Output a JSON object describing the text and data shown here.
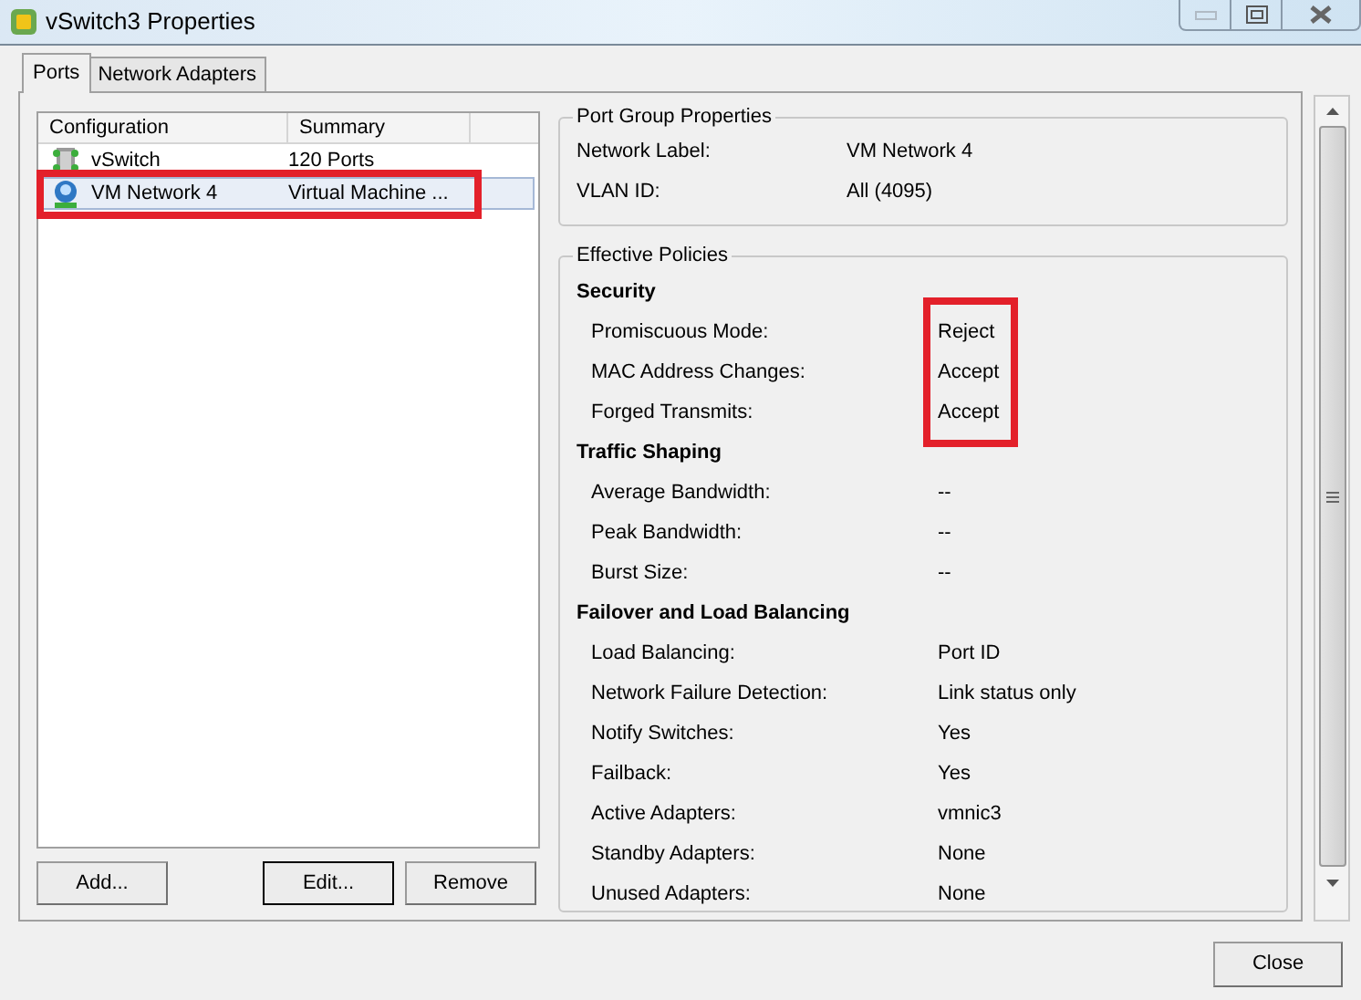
{
  "window": {
    "title": "vSwitch3 Properties"
  },
  "tabs": [
    {
      "label": "Ports",
      "selected": true
    },
    {
      "label": "Network Adapters",
      "selected": false
    }
  ],
  "port_list": {
    "columns": [
      "Configuration",
      "Summary"
    ],
    "rows": [
      {
        "kind": "switch",
        "configuration": "vSwitch",
        "summary": "120 Ports",
        "selected": false,
        "annotated": false
      },
      {
        "kind": "network",
        "configuration": "VM Network 4",
        "summary": "Virtual Machine ...",
        "selected": true,
        "annotated": true
      }
    ]
  },
  "list_buttons": [
    {
      "label": "Add...",
      "default": false
    },
    {
      "label": "Edit...",
      "default": true
    },
    {
      "label": "Remove",
      "default": false
    }
  ],
  "port_group_properties": {
    "title": "Port Group Properties",
    "rows": [
      {
        "label": "Network Label:",
        "value": "VM Network 4"
      },
      {
        "label": "VLAN ID:",
        "value": "All (4095)"
      }
    ]
  },
  "effective_policies": {
    "title": "Effective Policies",
    "sections": [
      {
        "heading": "Security",
        "annotated": true,
        "rows": [
          {
            "label": "Promiscuous Mode:",
            "value": "Reject"
          },
          {
            "label": "MAC Address Changes:",
            "value": "Accept"
          },
          {
            "label": "Forged Transmits:",
            "value": "Accept"
          }
        ]
      },
      {
        "heading": "Traffic Shaping",
        "annotated": false,
        "rows": [
          {
            "label": "Average Bandwidth:",
            "value": "--"
          },
          {
            "label": "Peak Bandwidth:",
            "value": "--"
          },
          {
            "label": "Burst Size:",
            "value": "--"
          }
        ]
      },
      {
        "heading": "Failover and Load Balancing",
        "annotated": false,
        "rows": [
          {
            "label": "Load Balancing:",
            "value": "Port ID"
          },
          {
            "label": "Network Failure Detection:",
            "value": "Link status only"
          },
          {
            "label": "Notify Switches:",
            "value": "Yes"
          },
          {
            "label": "Failback:",
            "value": "Yes"
          },
          {
            "label": "Active Adapters:",
            "value": "vmnic3"
          },
          {
            "label": "Standby Adapters:",
            "value": "None"
          },
          {
            "label": "Unused Adapters:",
            "value": "None"
          }
        ]
      }
    ]
  },
  "footer_buttons": [
    "Close"
  ]
}
